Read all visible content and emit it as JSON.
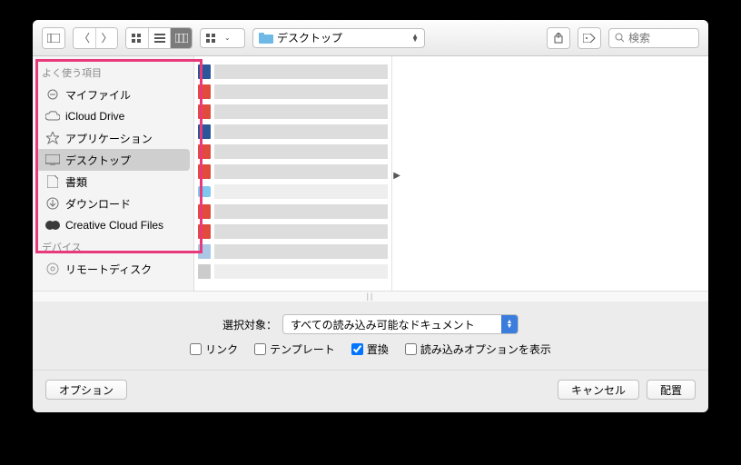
{
  "toolbar": {
    "location_label": "デスクトップ",
    "search_placeholder": "検索"
  },
  "sidebar": {
    "section_favorites": "よく使う項目",
    "section_devices": "デバイス",
    "favorites": [
      {
        "label": "マイファイル",
        "icon": "all-files-icon"
      },
      {
        "label": "iCloud Drive",
        "icon": "cloud-icon"
      },
      {
        "label": "アプリケーション",
        "icon": "applications-icon"
      },
      {
        "label": "デスクトップ",
        "icon": "desktop-icon"
      },
      {
        "label": "書類",
        "icon": "documents-icon"
      },
      {
        "label": "ダウンロード",
        "icon": "downloads-icon"
      },
      {
        "label": "Creative Cloud Files",
        "icon": "cc-icon"
      }
    ],
    "devices": [
      {
        "label": "リモートディスク",
        "icon": "remote-disk-icon"
      }
    ]
  },
  "enable": {
    "label": "選択対象：",
    "value": "すべての読み込み可能なドキュメント"
  },
  "options_row": {
    "link": "リンク",
    "template": "テンプレート",
    "replace": "置換",
    "show_import": "読み込みオプションを表示"
  },
  "footer": {
    "options": "オプション",
    "cancel": "キャンセル",
    "place": "配置"
  }
}
